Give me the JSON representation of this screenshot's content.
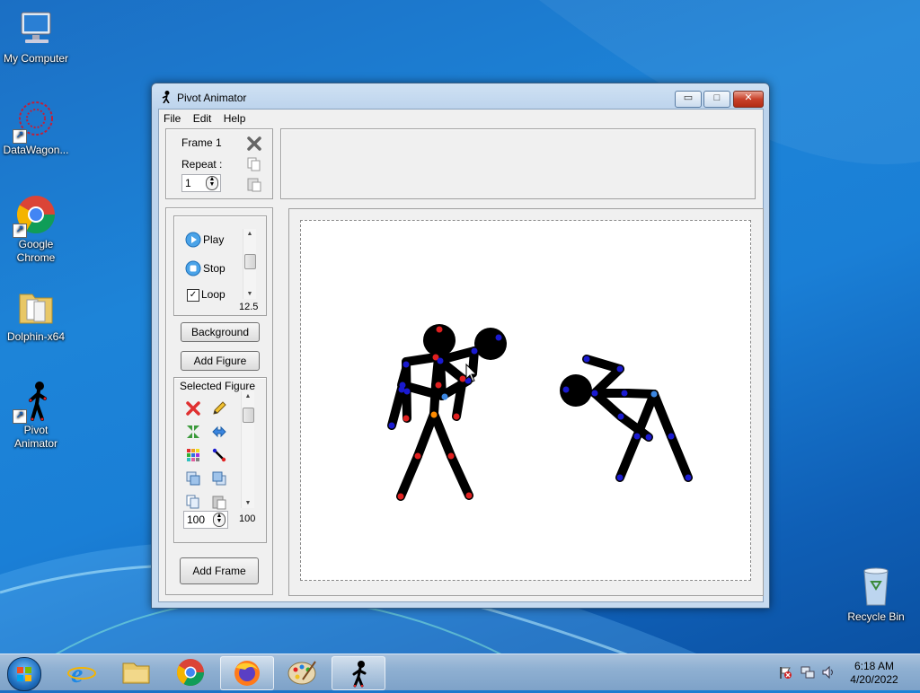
{
  "desktop": {
    "icons": [
      {
        "label": "My Computer"
      },
      {
        "label": "DataWagon..."
      },
      {
        "label": "Google Chrome"
      },
      {
        "label": "Dolphin-x64"
      },
      {
        "label": "Pivot Animator"
      },
      {
        "label": "Recycle Bin"
      }
    ]
  },
  "window": {
    "title": "Pivot Animator",
    "buttons": {
      "minimize": "▭",
      "maximize": "□",
      "close": "✕"
    },
    "menu": [
      "File",
      "Edit",
      "Help"
    ],
    "frame_panel": {
      "frame_label": "Frame 1",
      "repeat_label": "Repeat :",
      "repeat_value": "1"
    },
    "controls": {
      "play": "Play",
      "stop": "Stop",
      "loop": "Loop",
      "loop_checked": true,
      "speed": "12.5",
      "background": "Background",
      "add_figure": "Add Figure",
      "selected_figure": "Selected Figure",
      "size_value": "100",
      "scroll_value": "100",
      "add_frame": "Add Frame"
    }
  },
  "taskbar": {
    "time": "6:18 AM",
    "date": "4/20/2022"
  },
  "colors": {
    "joint_red": "#e02020",
    "joint_blue": "#1a1ad0",
    "joint_orange": "#ff8c00",
    "joint_lightblue": "#3b86e0"
  }
}
